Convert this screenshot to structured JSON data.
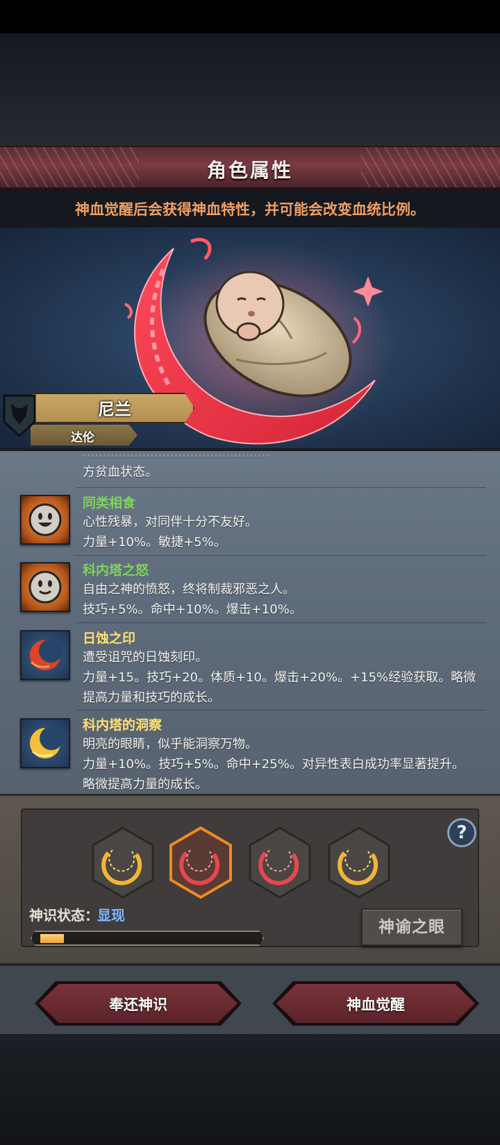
{
  "header": {
    "title": "角色属性",
    "subtitle": "神血觉醒后会获得神血特性，并可能会改变血统比例。"
  },
  "character": {
    "name": "尼兰",
    "bloodline": "达伦"
  },
  "traits": {
    "partial": {
      "line2": "方贫血状态。"
    },
    "items": [
      {
        "name": "同类相食",
        "name_color": "#7fd35a",
        "icon": "smiley-face-icon",
        "line1": "心性残暴，对同伴十分不友好。",
        "line2": "力量+10%。敏捷+5%。",
        "line3": ""
      },
      {
        "name": "科内塔之怒",
        "name_color": "#7fd35a",
        "icon": "smiley-face-icon",
        "line1": "自由之神的愤怒，终将制裁邪恶之人。",
        "line2": "技巧+5%。命中+10%。爆击+10%。",
        "line3": ""
      },
      {
        "name": "日蚀之印",
        "name_color": "#ffe070",
        "icon": "red-eclipse-icon",
        "line1": "遭受诅咒的日蚀刻印。",
        "line2": "力量+15。技巧+20。体质+10。爆击+20%。+15%经验获取。略微",
        "line3": "提高力量和技巧的成长。"
      },
      {
        "name": "科内塔的洞察",
        "name_color": "#ffe070",
        "icon": "gold-crescent-icon",
        "line1": "明亮的眼睛，似乎能洞察万物。",
        "line2": "力量+10%。技巧+5%。命中+25%。对异性表白成功率显著提升。",
        "line3": "略微提高力量的成长。"
      }
    ]
  },
  "runes": {
    "slots": [
      {
        "icon": "gold-crescent-rune-icon",
        "color": "#f2b634",
        "selected": false
      },
      {
        "icon": "red-crescent-rune-icon",
        "color": "#e8474f",
        "selected": true
      },
      {
        "icon": "red-crescent-rune-icon",
        "color": "#e8474f",
        "selected": false
      },
      {
        "icon": "gold-crescent-rune-icon",
        "color": "#f2b634",
        "selected": false
      }
    ],
    "help_label": "?",
    "status_label": "神识状态：",
    "status_value": "显现",
    "progress": 0.11,
    "oracle_button": "神谕之眼"
  },
  "actions": {
    "return_label": "奉还神识",
    "awaken_label": "神血觉醒"
  }
}
